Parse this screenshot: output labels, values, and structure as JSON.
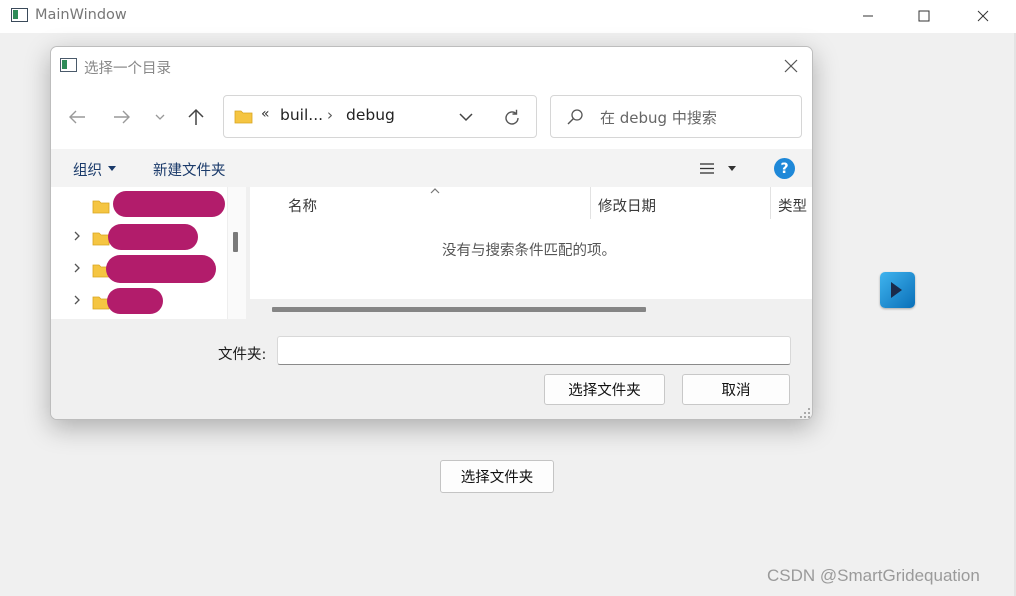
{
  "main_window": {
    "title": "MainWindow",
    "choose_button_label": "选择文件夹"
  },
  "dialog": {
    "title": "选择一个目录",
    "address": {
      "chevrons": "«",
      "crumbs": [
        "buil...",
        "debug"
      ],
      "separator": "›"
    },
    "search_placeholder": "在 debug 中搜索",
    "toolbar": {
      "organize_label": "组织",
      "new_folder_label": "新建文件夹",
      "help_label": "?"
    },
    "columns": {
      "name": "名称",
      "modified": "修改日期",
      "type": "类型"
    },
    "empty_message": "没有与搜索条件匹配的项。",
    "folder_label": "文件夹:",
    "folder_value": "",
    "select_button_label": "选择文件夹",
    "cancel_button_label": "取消"
  },
  "icons": {
    "back": "arrow-left-icon",
    "forward": "arrow-right-icon",
    "recent": "chevron-down-icon",
    "up": "arrow-up-icon",
    "refresh": "refresh-icon",
    "search": "search-icon",
    "view": "list-view-icon",
    "help": "help-icon",
    "folder": "folder-icon"
  },
  "colors": {
    "accent": "#1e88d8",
    "redaction": "#b21c6b",
    "folder_yellow": "#f5c542"
  },
  "watermark": "CSDN @SmartGridequation"
}
